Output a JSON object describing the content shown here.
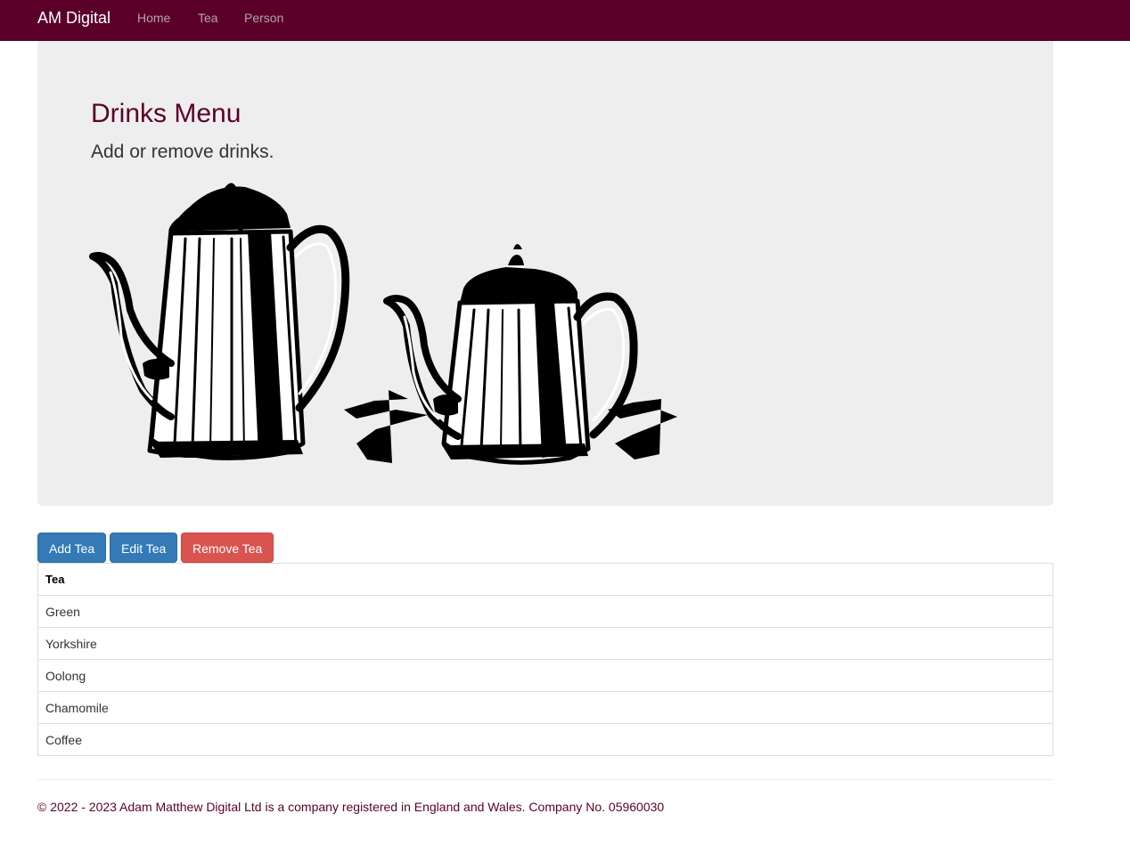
{
  "navbar": {
    "brand": "AM Digital",
    "links": [
      "Home",
      "Tea",
      "Person"
    ],
    "background": "#5b0029"
  },
  "jumbotron": {
    "title": "Drinks Menu",
    "subtitle": "Add or remove drinks.",
    "image": "two-teapots-illustration"
  },
  "actions": {
    "add_label": "Add Tea",
    "edit_label": "Edit Tea",
    "remove_label": "Remove Tea"
  },
  "table": {
    "header": "Tea",
    "rows": [
      "Green",
      "Yorkshire",
      "Oolong",
      "Chamomile",
      "Coffee"
    ]
  },
  "footer": {
    "text": "© 2022 - 2023 Adam Matthew Digital Ltd is a company registered in England and Wales. Company No. 05960030"
  }
}
